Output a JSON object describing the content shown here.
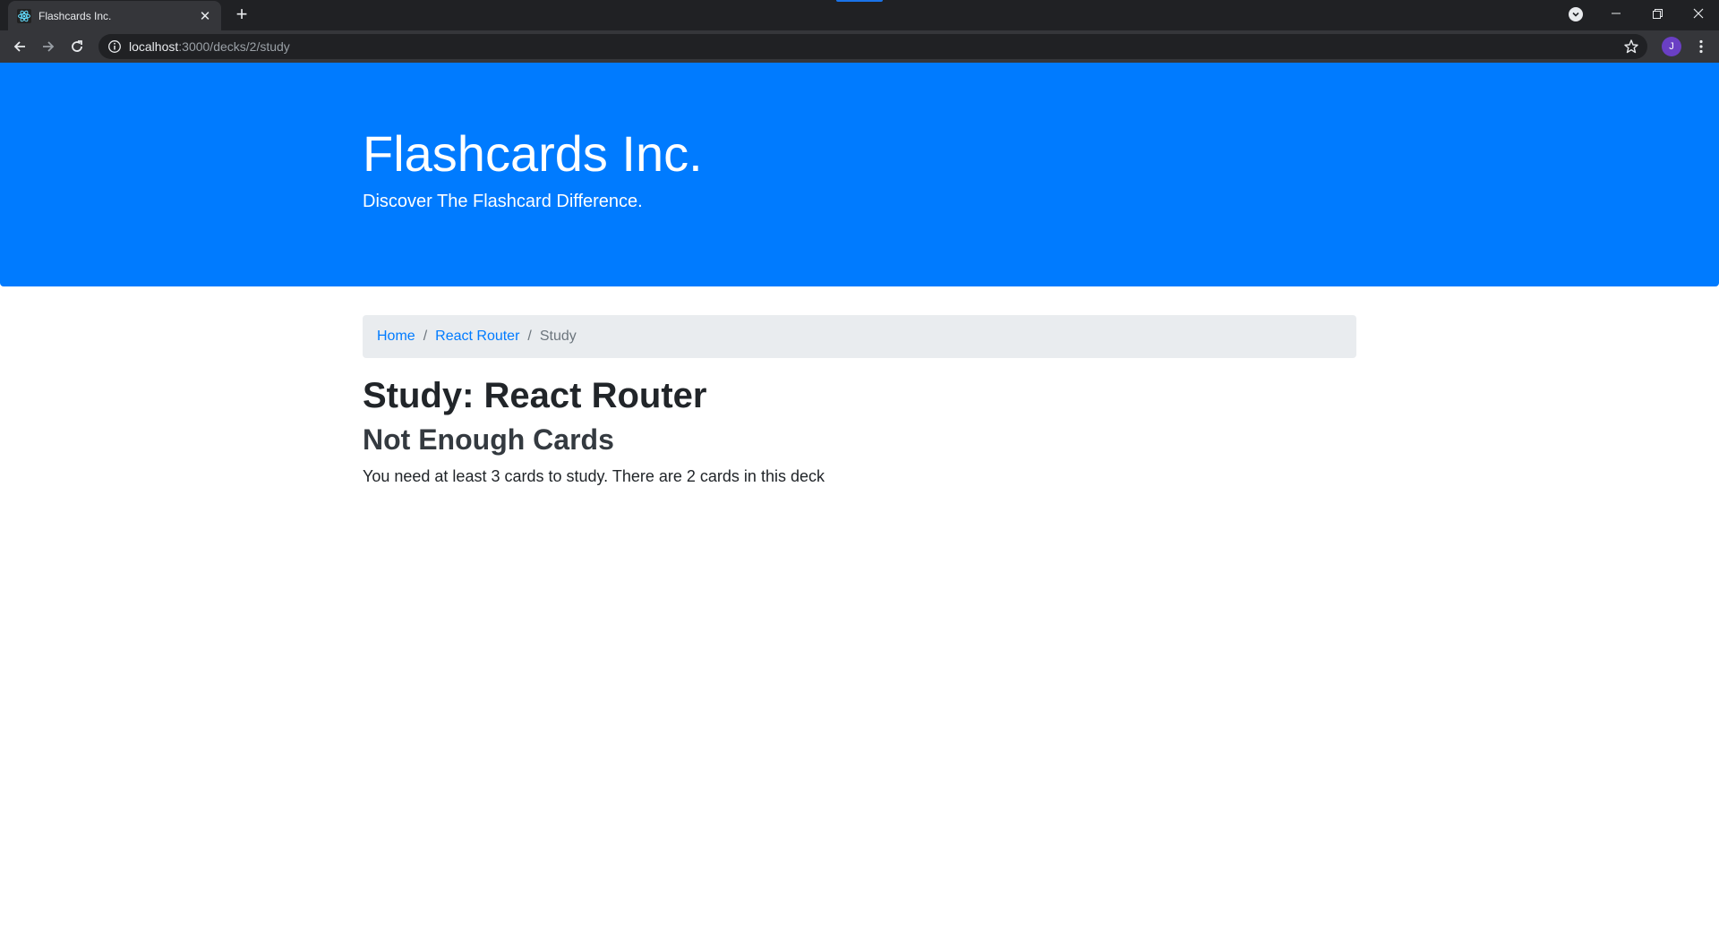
{
  "browser": {
    "tab_title": "Flashcards Inc.",
    "url_host": "localhost",
    "url_path": ":3000/decks/2/study",
    "profile_initial": "J"
  },
  "header": {
    "brand": "Flashcards Inc.",
    "tagline": "Discover The Flashcard Difference."
  },
  "breadcrumb": {
    "home": "Home",
    "deck": "React Router",
    "current": "Study",
    "separator": "/"
  },
  "main": {
    "title": "Study: React Router",
    "subtitle": "Not Enough Cards",
    "message": "You need at least 3 cards to study. There are 2 cards in this deck"
  },
  "colors": {
    "primary": "#007bff",
    "breadcrumb_bg": "#e9ecef",
    "avatar": "#6a3fc4"
  }
}
